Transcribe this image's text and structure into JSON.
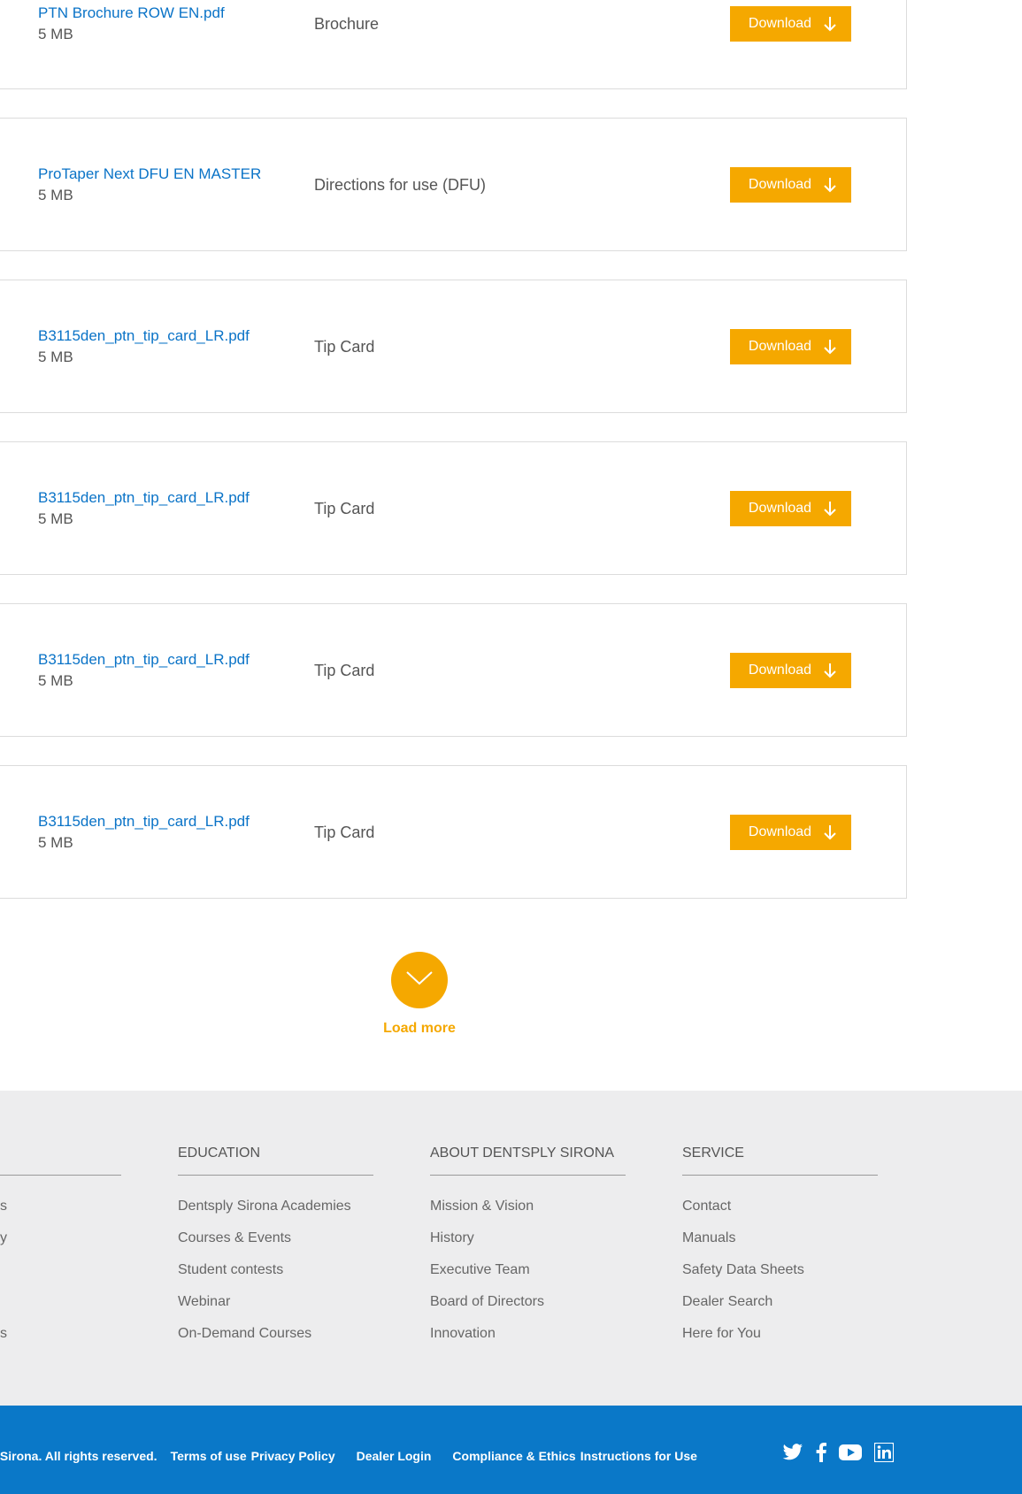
{
  "downloads": [
    {
      "name": "PTN Brochure ROW EN.pdf",
      "size": "5 MB",
      "type": "Brochure",
      "button": "Download"
    },
    {
      "name": "ProTaper Next DFU EN MASTER",
      "size": "5 MB",
      "type": "Directions for use (DFU)",
      "button": "Download"
    },
    {
      "name": "B3115den_ptn_tip_card_LR.pdf",
      "size": "5 MB",
      "type": "Tip Card",
      "button": "Download"
    },
    {
      "name": "B3115den_ptn_tip_card_LR.pdf",
      "size": "5 MB",
      "type": "Tip Card",
      "button": "Download"
    },
    {
      "name": "B3115den_ptn_tip_card_LR.pdf",
      "size": "5 MB",
      "type": "Tip Card",
      "button": "Download"
    },
    {
      "name": "B3115den_ptn_tip_card_LR.pdf",
      "size": "5 MB",
      "type": "Tip Card",
      "button": "Download"
    }
  ],
  "load_more": {
    "label": "Load more"
  },
  "footer": {
    "partial_col": {
      "items": [
        "s",
        "y",
        "",
        "",
        "s"
      ]
    },
    "education": {
      "title": "EDUCATION",
      "items": [
        "Dentsply Sirona Academies",
        "Courses & Events",
        "Student contests",
        "Webinar",
        "On-Demand Courses"
      ]
    },
    "about": {
      "title": "ABOUT DENTSPLY SIRONA",
      "items": [
        "Mission & Vision",
        "History",
        "Executive Team",
        "Board of Directors",
        "Innovation"
      ]
    },
    "service": {
      "title": "SERVICE",
      "items": [
        "Contact",
        "Manuals",
        "Safety Data Sheets",
        "Dealer Search",
        "Here for You"
      ]
    }
  },
  "bottombar": {
    "copyright": "sply Sirona. All rights reserved.",
    "links": [
      "Terms of use",
      "Privacy Policy",
      "Dealer Login",
      "Compliance & Ethics",
      "Instructions for Use"
    ],
    "social": [
      "twitter-icon",
      "facebook-icon",
      "youtube-icon",
      "linkedin-icon"
    ]
  },
  "colors": {
    "accent": "#f5a800",
    "link": "#0a73c7",
    "footer_bg": "#ededee",
    "bar_bg": "#0a78c8"
  }
}
